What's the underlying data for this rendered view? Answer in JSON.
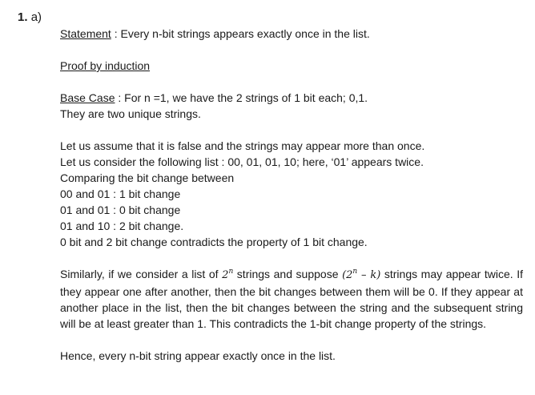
{
  "question": {
    "number": "1.",
    "part": "a)"
  },
  "statement": {
    "label": "Statement",
    "text": " : Every n-bit strings appears exactly once in the list."
  },
  "proof_heading": "Proof by induction",
  "base_case": {
    "label": "Base Case",
    "text": " : For n =1, we have the 2 strings of 1 bit each; 0,1.",
    "line2": "They are two unique strings."
  },
  "assumption": {
    "lines": [
      "Let us assume that it is false and the strings may appear more than once.",
      "Let us consider the following list : 00, 01, 01, 10; here, ‘01’ appears twice.",
      "Comparing the bit change between",
      "00 and 01 : 1 bit change",
      "01 and 01 : 0 bit change",
      "01 and 10 : 2 bit change.",
      "0 bit and 2 bit change contradicts the property of 1 bit change."
    ]
  },
  "similarly": {
    "part1": "Similarly, if we consider a list of ",
    "math1_base": "2",
    "math1_exp": "n",
    "part2": " strings and suppose ",
    "math2_open": "(2",
    "math2_exp": "n",
    "math2_rest": " – k)",
    "part3": " strings may appear twice. If they appear one after another, then the bit changes between them will be 0. If they appear at another place in the list, then the bit changes between the string and the subsequent string will be at least greater than 1. This contradicts the 1-bit change property of the strings."
  },
  "conclusion": "Hence, every n-bit string appear exactly once in the list."
}
